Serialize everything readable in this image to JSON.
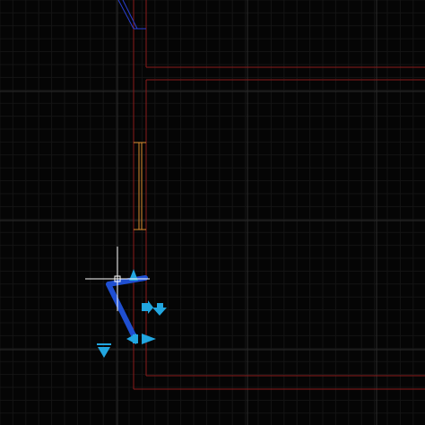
{
  "colors": {
    "background": "#050505",
    "grid_minor": "#141414",
    "grid_major": "#2a2a2a",
    "wall_red": "#8a1a1a",
    "window_orange": "#d98a2e",
    "selection_blue": "#1f4fd1",
    "grip_cyan": "#22a6e0",
    "crosshair": "#ffffff"
  },
  "icons": {
    "grip_up": "triangle-up-grip-icon",
    "grip_right": "triangle-right-grip-icon",
    "grip_down": "triangle-down-grip-icon",
    "grip_stretch": "double-arrow-grip-icon",
    "cursor": "crosshair-cursor-icon"
  }
}
